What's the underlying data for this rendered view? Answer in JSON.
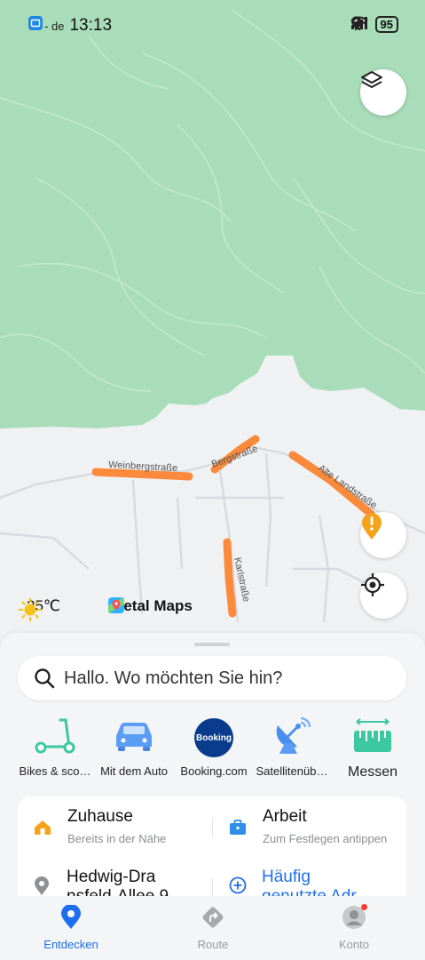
{
  "status_bar": {
    "carrier": "o2 - de",
    "time": "13:13",
    "battery": "95"
  },
  "map": {
    "street_labels": [
      "Weinbergstraße",
      "Bergstraße",
      "Alte Landstraße",
      "Karlstraße"
    ],
    "weather": {
      "temperature": "25℃",
      "icon": "sun-icon"
    },
    "brand": "Petal Maps",
    "colors": {
      "forest": "#a9dcb8",
      "route_highlight": "#fb8a3c",
      "warning": "#f7a21b"
    }
  },
  "search": {
    "placeholder": "Hallo. Wo möchten Sie hin?"
  },
  "quick_actions": [
    {
      "label": "Bikes & sco…",
      "icon": "scooter-icon"
    },
    {
      "label": "Mit dem Auto",
      "icon": "car-icon"
    },
    {
      "label": "Booking.com",
      "icon": "booking-icon",
      "icon_text": "Booking"
    },
    {
      "label": "Satellitenüb…",
      "icon": "satellite-dish-icon"
    },
    {
      "label": "Messen",
      "icon": "ruler-icon"
    }
  ],
  "favorites": {
    "home": {
      "title": "Zuhause",
      "subtitle": "Bereits in der Nähe"
    },
    "work": {
      "title": "Arbeit",
      "subtitle": "Zum Festlegen antippen"
    },
    "recent": {
      "title_line1": "Hedwig-Dra",
      "title_line2": "nsfeld-Allee 9"
    },
    "frequent": {
      "title_line1": "Häufig",
      "title_line2": "genutzte Adr"
    }
  },
  "bottom_nav": [
    {
      "label": "Entdecken",
      "icon": "location-pin-icon",
      "active": true
    },
    {
      "label": "Route",
      "icon": "route-icon",
      "active": false
    },
    {
      "label": "Konto",
      "icon": "account-icon",
      "active": false
    }
  ]
}
